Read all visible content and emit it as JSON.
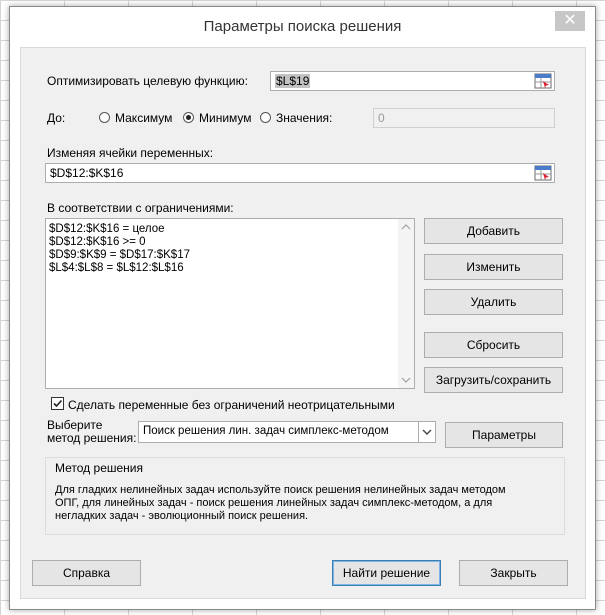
{
  "dialog": {
    "title": "Параметры поиска решения",
    "close_label": "✕"
  },
  "objective": {
    "label": "Оптимизировать целевую функцию:",
    "value": "$L$19"
  },
  "to": {
    "label": "До:",
    "options": [
      {
        "label": "Максимум",
        "selected": false
      },
      {
        "label": "Минимум",
        "selected": true
      },
      {
        "label": "Значения:",
        "selected": false
      }
    ],
    "value_field": "0"
  },
  "variables": {
    "label": "Изменяя ячейки переменных:",
    "value": "$D$12:$K$16"
  },
  "constraints": {
    "label": "В соответствии с ограничениями:",
    "items": [
      "$D$12:$K$16 = целое",
      "$D$12:$K$16 >= 0",
      "$D$9:$K$9 = $D$17:$K$17",
      "$L$4:$L$8 = $L$12:$L$16"
    ]
  },
  "buttons": {
    "add": "Добавить",
    "change": "Изменить",
    "delete": "Удалить",
    "reset": "Сбросить",
    "load_save": "Загрузить/сохранить",
    "params": "Параметры",
    "help": "Справка",
    "solve": "Найти решение",
    "close": "Закрыть"
  },
  "nonneg": {
    "label": "Сделать переменные без ограничений неотрицательными",
    "checked": true
  },
  "method": {
    "label_line1": "Выберите",
    "label_line2": "метод решения:",
    "selected": "Поиск решения лин. задач симплекс-методом"
  },
  "method_desc": {
    "title": "Метод решения",
    "lines": [
      "Для гладких нелинейных задач используйте поиск решения нелинейных задач методом",
      "ОПГ, для линейных задач - поиск решения линейных задач симплекс-методом, а для",
      "негладких задач - эволюционный поиск решения."
    ]
  }
}
